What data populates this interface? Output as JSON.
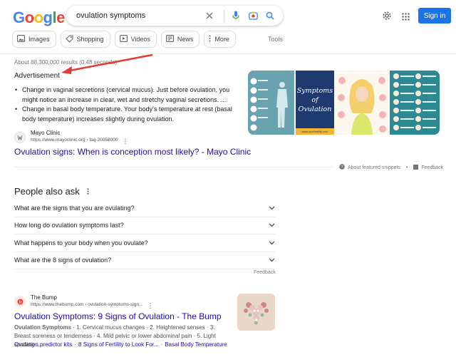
{
  "header": {
    "logo_letters": [
      {
        "ch": "G",
        "color": "#4285f4"
      },
      {
        "ch": "o",
        "color": "#ea4335"
      },
      {
        "ch": "o",
        "color": "#fbbc05"
      },
      {
        "ch": "g",
        "color": "#4285f4"
      },
      {
        "ch": "l",
        "color": "#34a853"
      },
      {
        "ch": "e",
        "color": "#ea4335"
      }
    ],
    "query": "ovulation symptoms",
    "signin_label": "Sign in"
  },
  "chips": [
    {
      "label": "Images",
      "icon": "image-icon"
    },
    {
      "label": "Shopping",
      "icon": "tag-icon"
    },
    {
      "label": "Videos",
      "icon": "play-icon"
    },
    {
      "label": "News",
      "icon": "news-icon"
    },
    {
      "label": "More",
      "icon": "more-vert-icon"
    }
  ],
  "tools_label": "Tools",
  "stats": "About 88,300,000 results (0.48 seconds)",
  "featured": {
    "advert_label": "Advertisement",
    "bullets": [
      "Change in vaginal secretions (cervical mucus). Just before ovulation, you might notice an increase in clear, wet and stretchy vaginal secretions. ...",
      "Change in basal body temperature. Your body's temperature at rest (basal body temperature) increases slightly during ovulation."
    ],
    "source_name": "Mayo Clinic",
    "source_url": "https://www.mayoclinic.org › faq-20058000",
    "title": "Ovulation signs: When is conception most likely? - Mayo Clinic",
    "image2_text": [
      "Symptoms",
      "of",
      "Ovulation"
    ],
    "image2_footer": "www.lucefertility.com",
    "about_label": "About featured snippets",
    "feedback_label": "Feedback",
    "separator": "•"
  },
  "paa": {
    "title": "People also ask",
    "questions": [
      "What are the signs that you are ovulating?",
      "How long do ovulation symptoms last?",
      "What happens to your body when you ovulate?",
      "What are the 8 signs of ovulation?"
    ],
    "feedback_label": "Feedback"
  },
  "result": {
    "source_name": "The Bump",
    "source_url": "https://www.thebump.com › ovulation-symptoms-sign...",
    "title": "Ovulation Symptoms: 9 Signs of Ovulation - The Bump",
    "desc_bold": "Ovulation Symptoms",
    "desc_rest": " · 1. Cervical mucus changes · 2. Heightened senses · 3. Breast soreness or tenderness · 4. Mild pelvic or lower abdominal pain · 5. Light spotting ...",
    "links": [
      "Ovulation predictor kits",
      "8 Signs of Fertility to Look For...",
      "Basal Body Temperature"
    ],
    "link_separator": "·"
  },
  "colors": {
    "link": "#1a0dab",
    "accent": "#1a73e8",
    "arrow": "#e53935"
  }
}
